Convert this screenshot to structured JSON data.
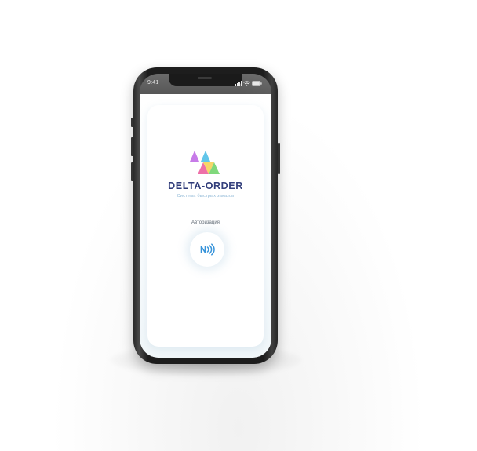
{
  "status_bar": {
    "time": "9:41",
    "icons": [
      "signal-icon",
      "wifi-icon",
      "battery-icon"
    ]
  },
  "app": {
    "brand_name": "DELTA-ORDER",
    "tagline": "Система быстрых заказов",
    "auth_label": "Авторизация",
    "nfc_icon": "nfc-icon"
  },
  "colors": {
    "brand_text": "#2e3a78",
    "tagline_text": "#8fb8d6",
    "nfc_accent": "#2f8fd8",
    "logo_purple": "#c77be8",
    "logo_cyan": "#62c6ea",
    "logo_pink": "#ee6fa8",
    "logo_yellow": "#f6d157",
    "logo_green": "#7ed87a"
  }
}
